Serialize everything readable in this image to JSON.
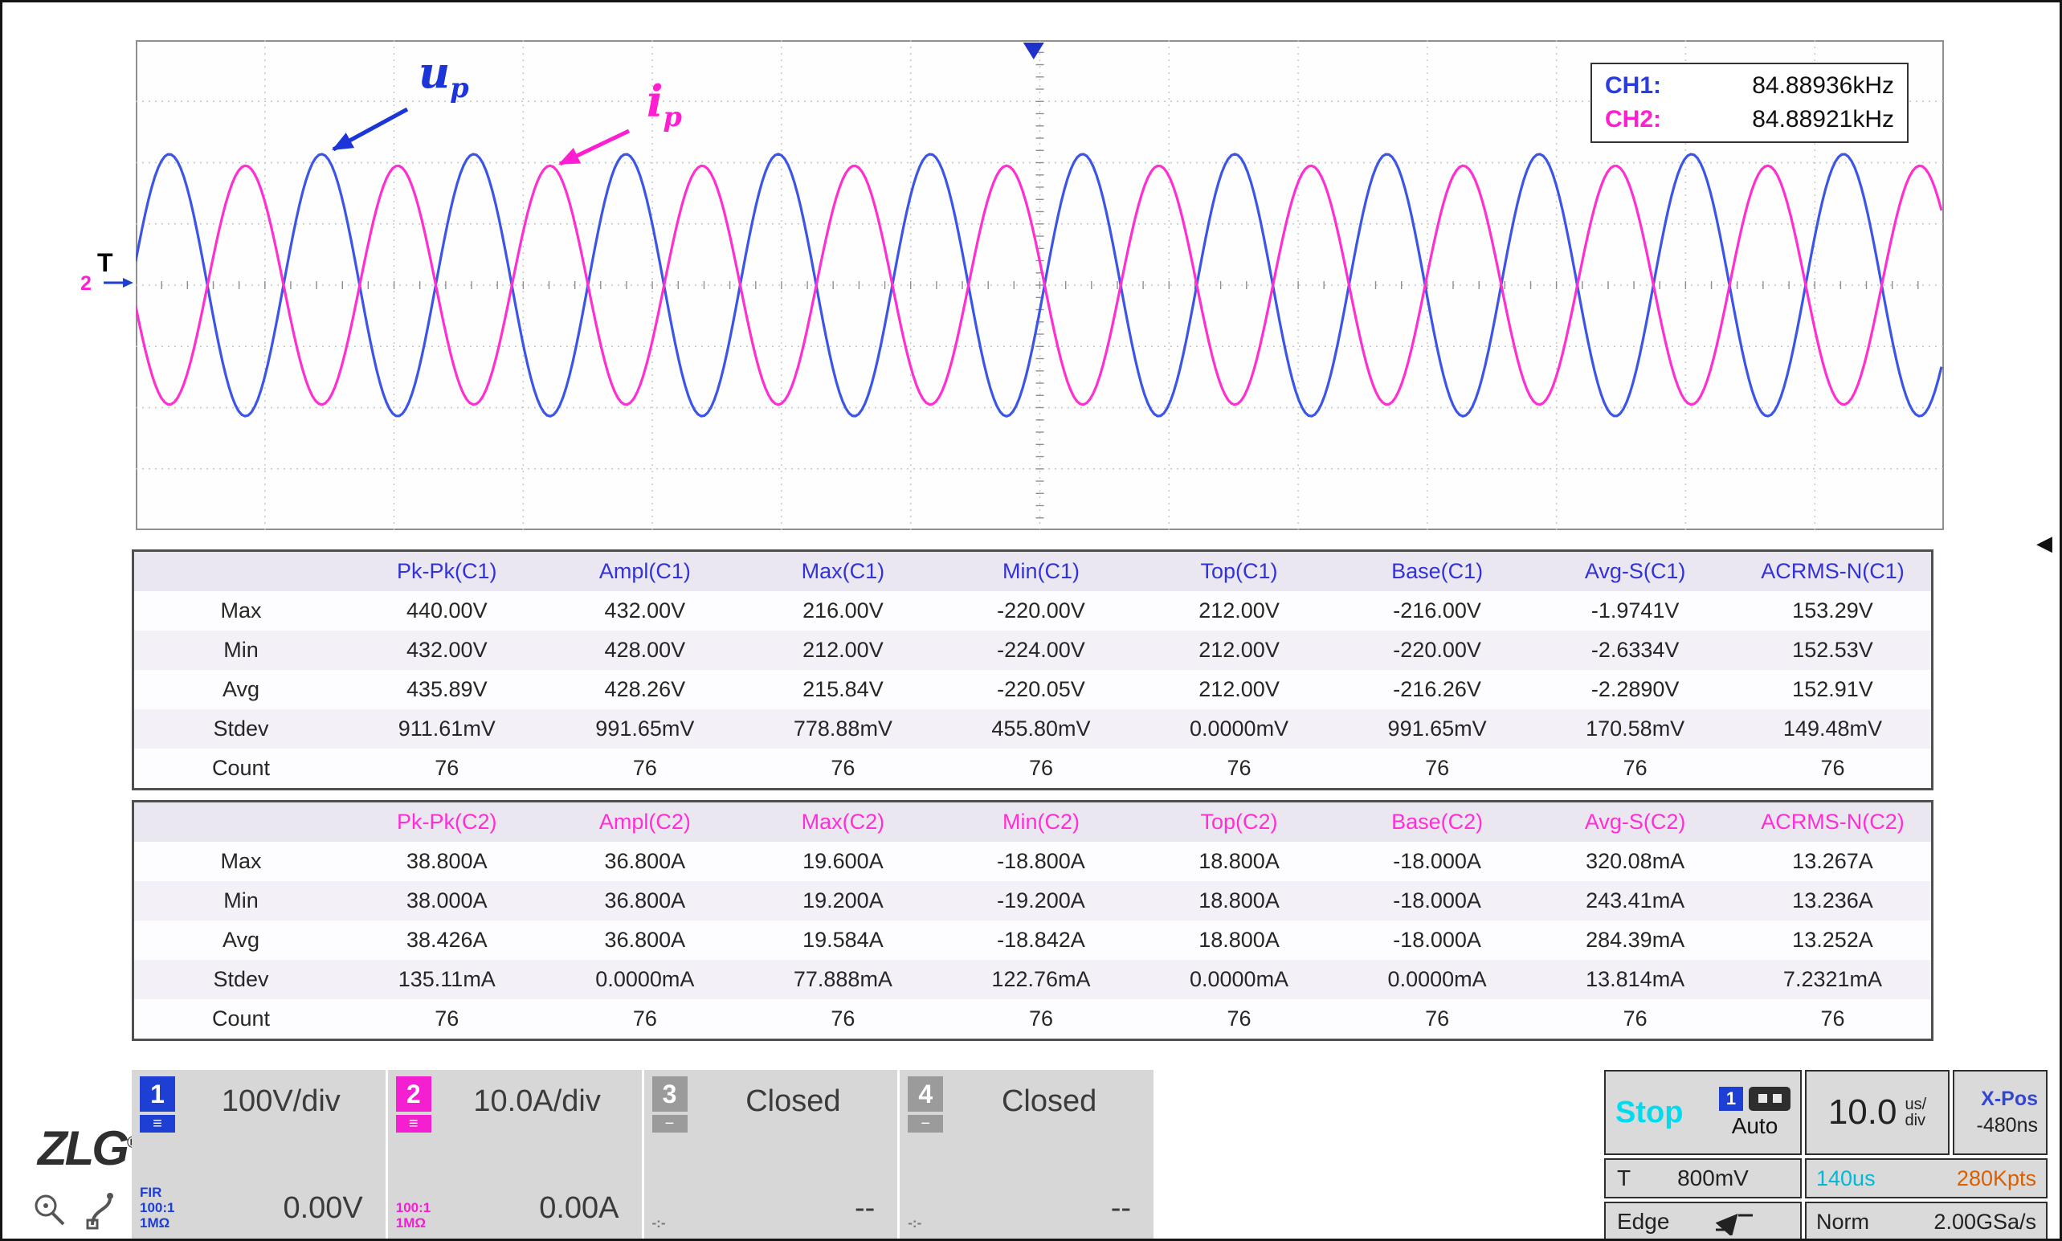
{
  "plot": {
    "trigger_marker": "T",
    "ch2_zero_marker": "2",
    "freq_box": {
      "ch1_label": "CH1:",
      "ch1_value": "84.88936kHz",
      "ch2_label": "CH2:",
      "ch2_value": "84.88921kHz"
    },
    "annotations": {
      "ch1_symbol": "u",
      "ch1_subscript": "p",
      "ch2_symbol": "i",
      "ch2_subscript": "p"
    }
  },
  "chart_data": {
    "type": "line",
    "title": "Oscilloscope traces: primary voltage and current",
    "x_axis": {
      "time_per_div": "10.0us/div",
      "divisions": 14,
      "total_time": "140us"
    },
    "y_axis": {
      "divisions": 8,
      "ch1_scale": "100V/div",
      "ch2_scale": "10.0A/div"
    },
    "divisions_x": 14,
    "divisions_y": 8,
    "trigger_x_div": -0.048,
    "grid": "dotted",
    "series": [
      {
        "id": "ch1",
        "name": "up (CH1)",
        "color": "#3c55e6",
        "frequency_khz": 84.88936,
        "amplitude_div": 2.14,
        "period_div": 1.1785,
        "peak_x_div": 0.26,
        "max": "216.00V",
        "min": "-220.00V"
      },
      {
        "id": "ch2",
        "name": "ip (CH2)",
        "color": "#ff2fd0",
        "frequency_khz": 84.88921,
        "amplitude_div": 1.95,
        "period_div": 1.1785,
        "peak_x_div": 0.85,
        "max": "19.600A",
        "min": "-18.800A"
      }
    ]
  },
  "tables": [
    {
      "channel": "C1",
      "header_color": "#3232d8",
      "headers": [
        "",
        "Pk-Pk(C1)",
        "Ampl(C1)",
        "Max(C1)",
        "Min(C1)",
        "Top(C1)",
        "Base(C1)",
        "Avg-S(C1)",
        "ACRMS-N(C1)"
      ],
      "rows": [
        {
          "label": "Max",
          "values": [
            "440.00V",
            "432.00V",
            "216.00V",
            "-220.00V",
            "212.00V",
            "-216.00V",
            "-1.9741V",
            "153.29V"
          ]
        },
        {
          "label": "Min",
          "values": [
            "432.00V",
            "428.00V",
            "212.00V",
            "-224.00V",
            "212.00V",
            "-220.00V",
            "-2.6334V",
            "152.53V"
          ]
        },
        {
          "label": "Avg",
          "values": [
            "435.89V",
            "428.26V",
            "215.84V",
            "-220.05V",
            "212.00V",
            "-216.26V",
            "-2.2890V",
            "152.91V"
          ]
        },
        {
          "label": "Stdev",
          "values": [
            "911.61mV",
            "991.65mV",
            "778.88mV",
            "455.80mV",
            "0.0000mV",
            "991.65mV",
            "170.58mV",
            "149.48mV"
          ]
        },
        {
          "label": "Count",
          "values": [
            "76",
            "76",
            "76",
            "76",
            "76",
            "76",
            "76",
            "76"
          ]
        }
      ]
    },
    {
      "channel": "C2",
      "header_color": "#ff2fd6",
      "headers": [
        "",
        "Pk-Pk(C2)",
        "Ampl(C2)",
        "Max(C2)",
        "Min(C2)",
        "Top(C2)",
        "Base(C2)",
        "Avg-S(C2)",
        "ACRMS-N(C2)"
      ],
      "rows": [
        {
          "label": "Max",
          "values": [
            "38.800A",
            "36.800A",
            "19.600A",
            "-18.800A",
            "18.800A",
            "-18.000A",
            "320.08mA",
            "13.267A"
          ]
        },
        {
          "label": "Min",
          "values": [
            "38.000A",
            "36.800A",
            "19.200A",
            "-19.200A",
            "18.800A",
            "-18.000A",
            "243.41mA",
            "13.236A"
          ]
        },
        {
          "label": "Avg",
          "values": [
            "38.426A",
            "36.800A",
            "19.584A",
            "-18.842A",
            "18.800A",
            "-18.000A",
            "284.39mA",
            "13.252A"
          ]
        },
        {
          "label": "Stdev",
          "values": [
            "135.11mA",
            "0.0000mA",
            "77.888mA",
            "122.76mA",
            "0.0000mA",
            "0.0000mA",
            "13.814mA",
            "7.2321mA"
          ]
        },
        {
          "label": "Count",
          "values": [
            "76",
            "76",
            "76",
            "76",
            "76",
            "76",
            "76",
            "76"
          ]
        }
      ]
    }
  ],
  "status_bar": {
    "brand": "ZLG",
    "registered": "®",
    "channels": [
      {
        "num": "1",
        "scale": "100V/div",
        "value": "0.00V",
        "probe_lines": [
          "FIR",
          "100:1",
          "1MΩ"
        ],
        "color": "#1d3fd4",
        "state": "on"
      },
      {
        "num": "2",
        "scale": "10.0A/div",
        "value": "0.00A",
        "probe_lines": [
          "100:1",
          "1MΩ"
        ],
        "color": "#f31fd0",
        "state": "on"
      },
      {
        "num": "3",
        "scale": "Closed",
        "value": "--",
        "probe_lines": [
          "-:-"
        ],
        "color": "#9b9b9b",
        "state": "off"
      },
      {
        "num": "4",
        "scale": "Closed",
        "value": "--",
        "probe_lines": [
          "-:-"
        ],
        "color": "#9b9b9b",
        "state": "off"
      }
    ],
    "run_state": "Stop",
    "trigger_channel": "1",
    "trigger_mode": "Auto",
    "timebase": {
      "value": "10.0",
      "unit_top": "us/",
      "unit_bottom": "div"
    },
    "x_pos": {
      "label": "X-Pos",
      "value": "-480ns"
    },
    "trigger": {
      "source_label": "T",
      "level": "800mV",
      "type": "Edge"
    },
    "record": {
      "time": "140us",
      "points": "280Kpts"
    },
    "sweep": "Norm",
    "sample_rate": "2.00GSa/s"
  }
}
